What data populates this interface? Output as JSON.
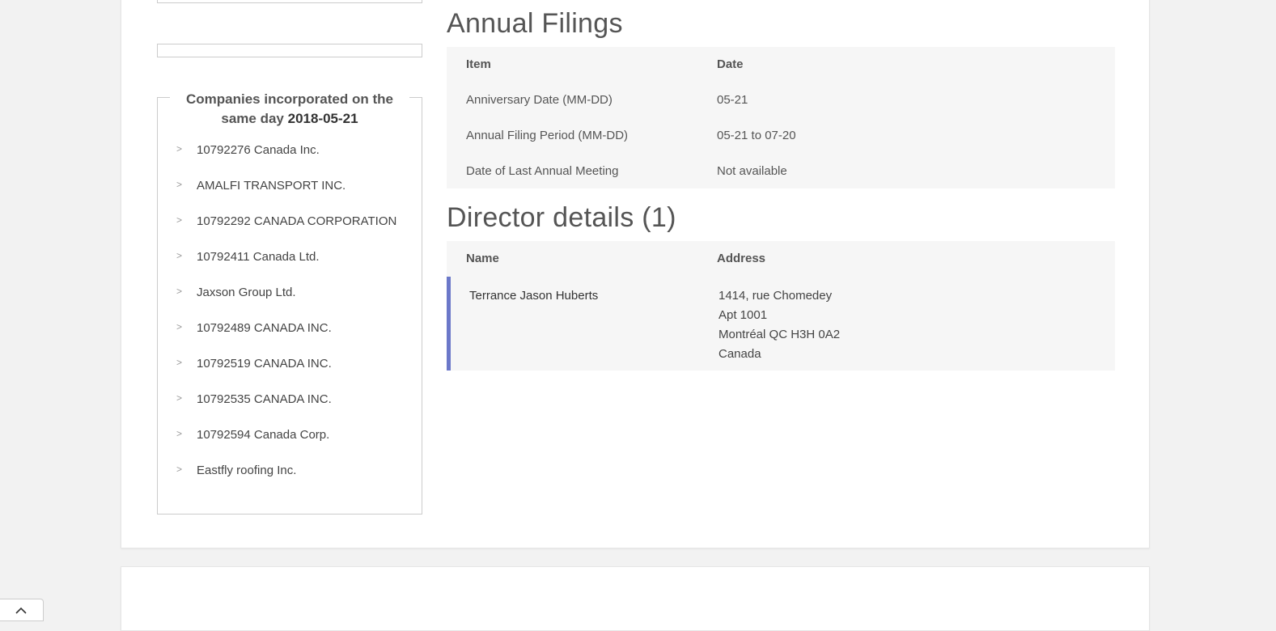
{
  "sidebar": {
    "legend_prefix": "Companies incorporated on the same day",
    "legend_date": "2018-05-21",
    "companies": [
      "10792276 Canada Inc.",
      "AMALFI TRANSPORT INC.",
      "10792292 CANADA CORPORATION",
      "10792411 Canada Ltd.",
      "Jaxson Group Ltd.",
      "10792489 CANADA INC.",
      "10792519 CANADA INC.",
      "10792535 CANADA INC.",
      "10792594 Canada Corp.",
      "Eastfly roofing Inc."
    ]
  },
  "annual_filings": {
    "title": "Annual Filings",
    "col_item": "Item",
    "col_date": "Date",
    "rows": [
      {
        "item": "Anniversary Date (MM-DD)",
        "date": "05-21"
      },
      {
        "item": "Annual Filing Period (MM-DD)",
        "date": "05-21 to 07-20"
      },
      {
        "item": "Date of Last Annual Meeting",
        "date": "Not available"
      }
    ]
  },
  "directors": {
    "title": "Director details (1)",
    "col_name": "Name",
    "col_address": "Address",
    "rows": [
      {
        "name": "Terrance Jason Huberts",
        "address": [
          "1414, rue Chomedey",
          "Apt 1001",
          "Montréal QC H3H 0A2",
          "Canada"
        ]
      }
    ]
  },
  "icons": {
    "list_bullet": "chevron-right-icon",
    "scroll_top": "chevron-up-icon"
  },
  "colors": {
    "director_accent": "#6b78c9"
  }
}
